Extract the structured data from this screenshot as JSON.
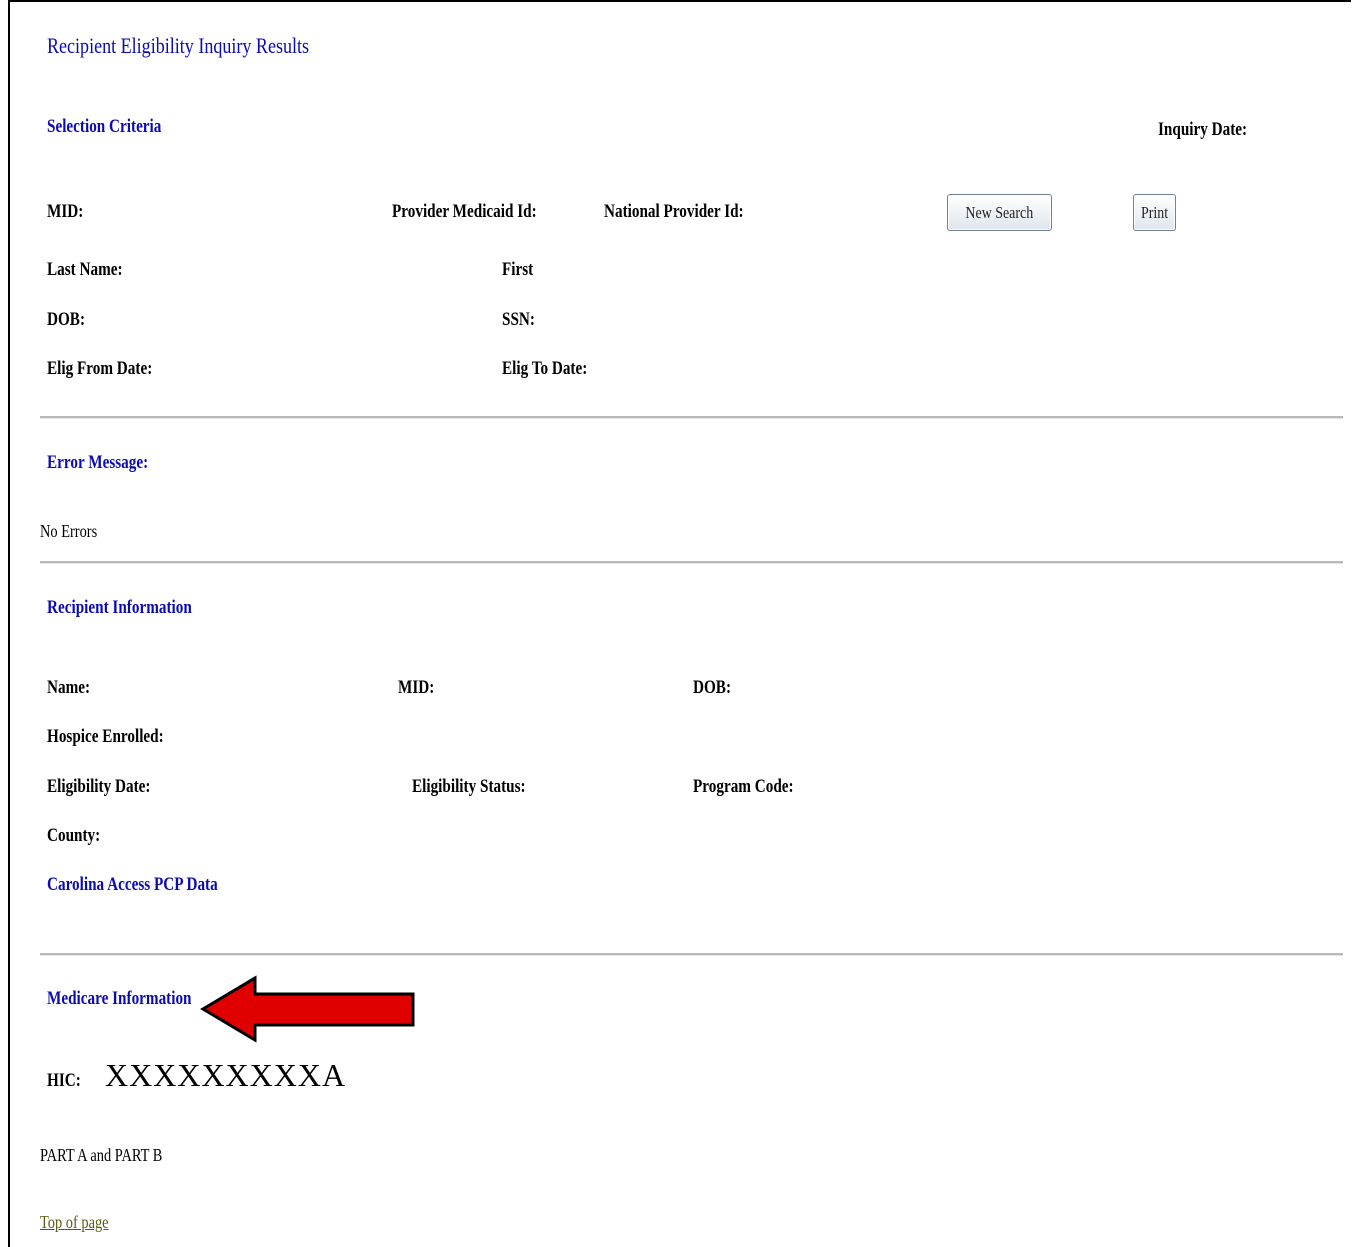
{
  "page": {
    "title": "Recipient Eligibility Inquiry Results"
  },
  "selection_criteria": {
    "heading": "Selection Criteria",
    "inquiry_date_label": "Inquiry Date:",
    "mid_label": "MID:",
    "provider_medicaid_id_label": "Provider Medicaid Id:",
    "national_provider_id_label": "National Provider Id:",
    "new_search_button": "New Search",
    "print_button": "Print",
    "last_name_label": "Last Name:",
    "first_label": "First",
    "dob_label": "DOB:",
    "ssn_label": "SSN:",
    "elig_from_label": "Elig From Date:",
    "elig_to_label": "Elig To Date:"
  },
  "error_section": {
    "heading": "Error Message:",
    "message": "No Errors"
  },
  "recipient_information": {
    "heading": "Recipient Information",
    "name_label": "Name:",
    "mid_label": "MID:",
    "dob_label": "DOB:",
    "hospice_label": "Hospice Enrolled:",
    "eligibility_date_label": "Eligibility Date:",
    "eligibility_status_label": "Eligibility Status:",
    "program_code_label": "Program Code:",
    "county_label": "County:",
    "carolina_access_label": "Carolina Access PCP Data"
  },
  "medicare_information": {
    "heading": "Medicare Information",
    "hic_label": "HIC:",
    "hic_value": "XXXXXXXXXA",
    "parts": "PART A and PART B",
    "arrow_color": "#e00000"
  },
  "footer": {
    "top_of_page_link": "Top of page"
  }
}
